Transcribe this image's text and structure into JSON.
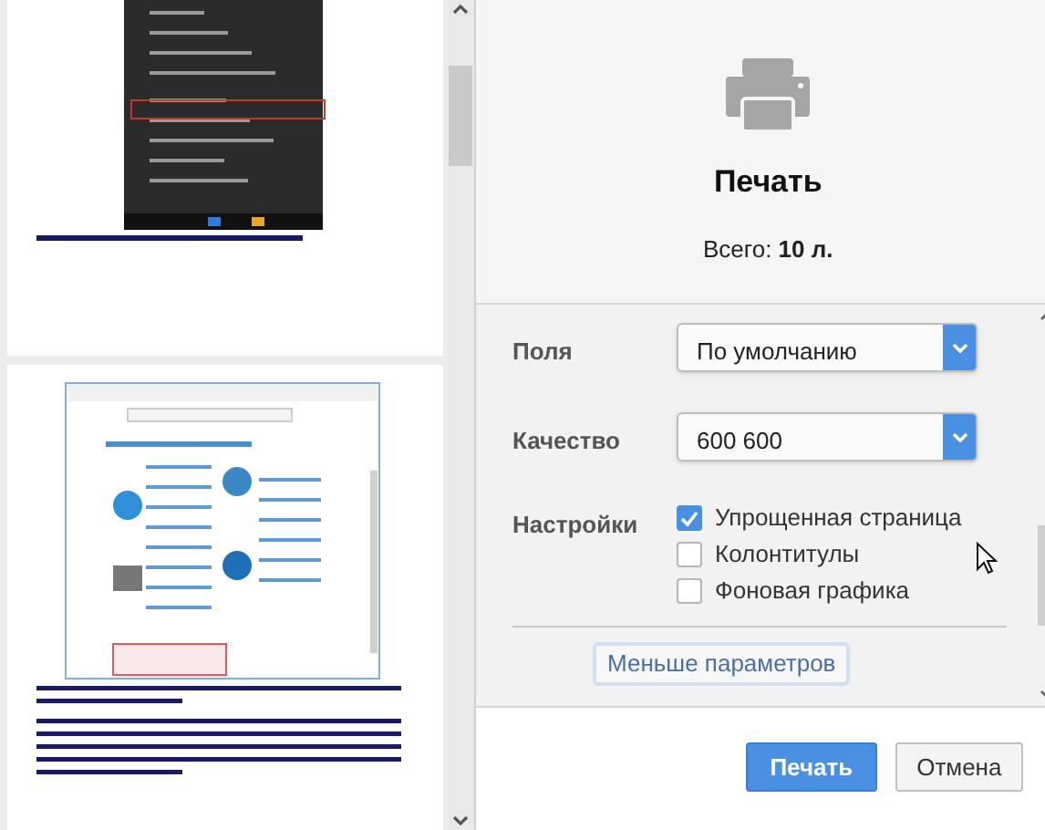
{
  "summary": {
    "title": "Печать",
    "total_label": "Всего:",
    "total_value": "10 л."
  },
  "settings": [
    {
      "kind": "select",
      "label": "Поля",
      "value": "По умолчанию"
    },
    {
      "kind": "select",
      "label": "Качество",
      "value": "600 600"
    },
    {
      "kind": "checks",
      "label": "Настройки",
      "options": [
        {
          "label": "Упрощенная страница",
          "checked": true
        },
        {
          "label": "Колонтитулы",
          "checked": false
        },
        {
          "label": "Фоновая графика",
          "checked": false
        }
      ]
    }
  ],
  "less_button": "Меньше параметров",
  "buttons": [
    {
      "label": "Печать",
      "primary": true
    },
    {
      "label": "Отмена",
      "primary": false
    }
  ]
}
